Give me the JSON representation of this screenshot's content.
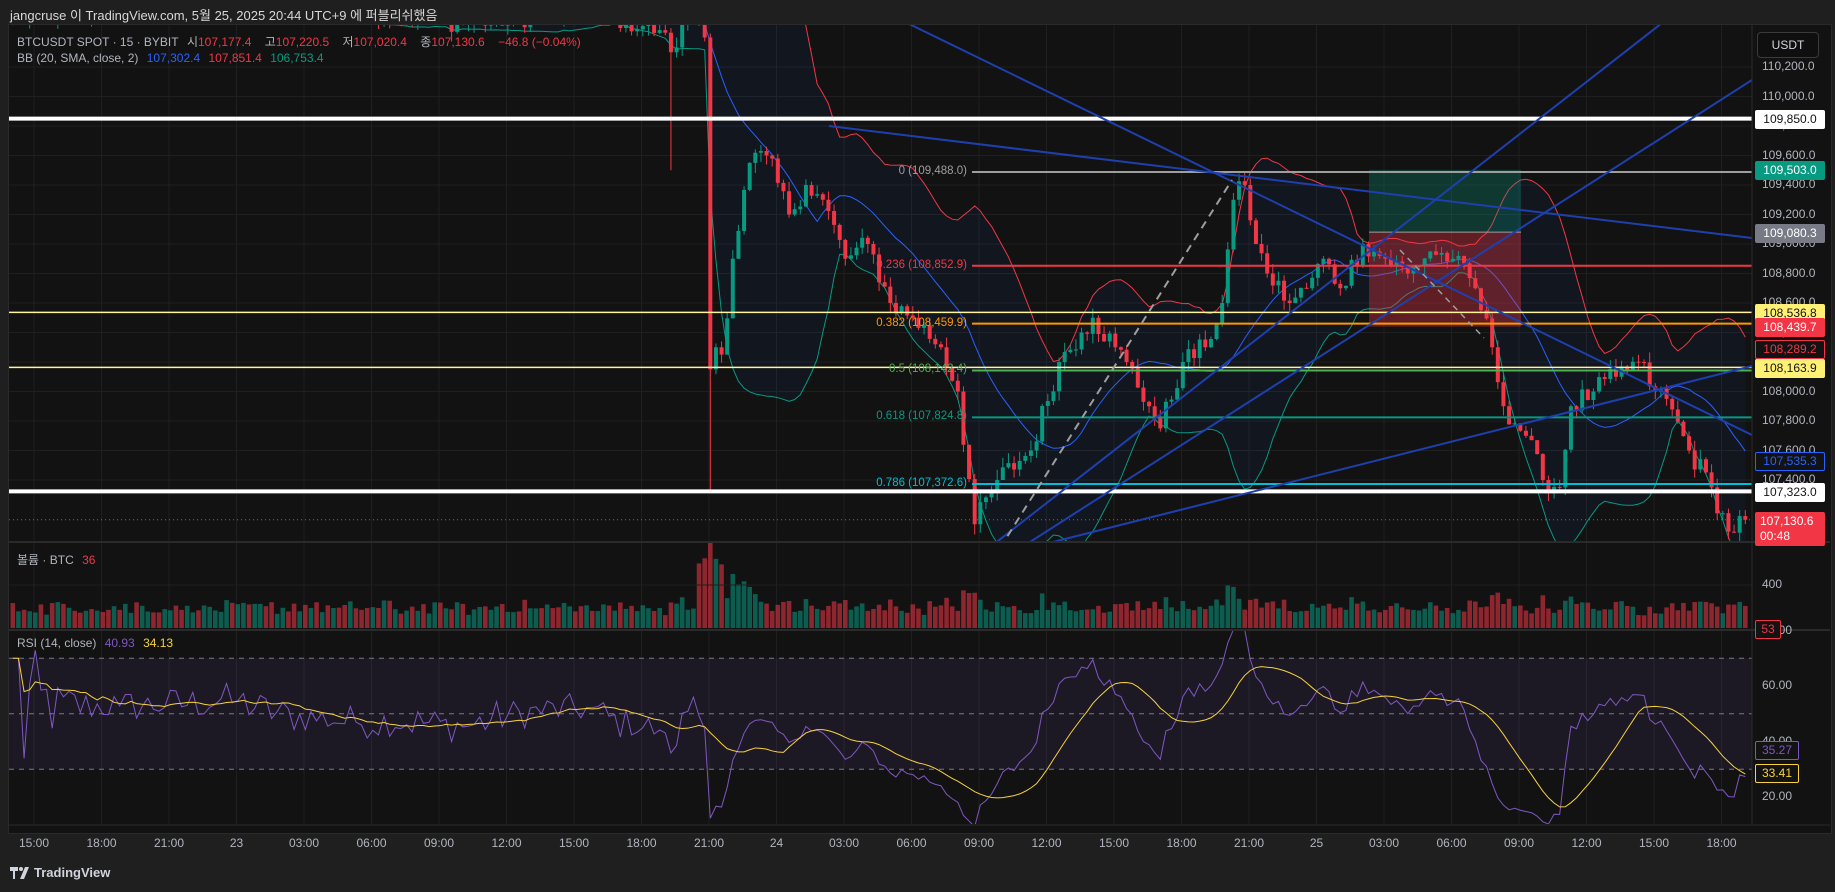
{
  "header": {
    "published": "jangcruse 이 TradingView.com, 5월 25, 2025 20:44 UTC+9 에 퍼블리쉬했음"
  },
  "legend": {
    "symbol": "BTCUSDT SPOT · 15 · BYBIT",
    "open_label": "시",
    "open": "107,177.4",
    "high_label": "고",
    "high": "107,220.5",
    "low_label": "저",
    "low": "107,020.4",
    "close_label": "종",
    "close": "107,130.6",
    "change": "−46.8 (−0.04%)",
    "bb_label": "BB (20, SMA, close, 2)",
    "bb_basis": "107,302.4",
    "bb_upper": "107,851.4",
    "bb_lower": "106,753.4",
    "volume_label": "볼륨 · BTC",
    "volume_value": "36",
    "rsi_label": "RSI (14, close)",
    "rsi_value": "40.93",
    "rsi_ma_value": "34.13"
  },
  "currency_button": "USDT",
  "footer": {
    "brand": "TradingView"
  },
  "colors": {
    "up": "#089981",
    "down": "#f23645",
    "bb_basis": "#2962ff",
    "bb_upper": "#f23645",
    "bb_lower": "#089981",
    "rsi": "#7e57c2",
    "rsi_ma": "#f7d23b",
    "trendline": "#1e40af"
  },
  "chart_data": {
    "type": "candlestick",
    "symbol": "BTCUSDT",
    "interval": "15",
    "price_axis": {
      "ticks": [
        "110,200.0",
        "110,000.0",
        "109,800.0",
        "109,600.0",
        "109,400.0",
        "109,200.0",
        "109,000.0",
        "108,800.0",
        "108,600.0",
        "108,400.0",
        "108,200.0",
        "108,000.0",
        "107,800.0",
        "107,600.0",
        "107,400.0"
      ],
      "tick_values": [
        110200,
        110000,
        109800,
        109600,
        109400,
        109200,
        109000,
        108800,
        108600,
        108400,
        108200,
        108000,
        107800,
        107600,
        107400
      ]
    },
    "time_axis": [
      "15:00",
      "18:00",
      "21:00",
      "23",
      "03:00",
      "06:00",
      "09:00",
      "12:00",
      "15:00",
      "18:00",
      "21:00",
      "24",
      "03:00",
      "06:00",
      "09:00",
      "12:00",
      "15:00",
      "18:00",
      "21:00",
      "25",
      "03:00",
      "06:00",
      "09:00",
      "12:00",
      "15:00",
      "18:00"
    ],
    "candle_count": 309,
    "close_keypoints": [
      [
        0,
        110550
      ],
      [
        19,
        110600
      ],
      [
        40,
        110700
      ],
      [
        61,
        110600
      ],
      [
        81,
        110500
      ],
      [
        102,
        110600
      ],
      [
        115,
        110450
      ],
      [
        117,
        110300
      ],
      [
        121,
        110600
      ],
      [
        123,
        110400
      ],
      [
        124,
        108150
      ],
      [
        125,
        108300
      ],
      [
        126,
        108250
      ],
      [
        128,
        108900
      ],
      [
        131,
        109550
      ],
      [
        134,
        109600
      ],
      [
        138,
        109200
      ],
      [
        141,
        109400
      ],
      [
        144,
        109300
      ],
      [
        148,
        108900
      ],
      [
        152,
        109000
      ],
      [
        156,
        108600
      ],
      [
        160,
        108500
      ],
      [
        165,
        108300
      ],
      [
        168,
        108000
      ],
      [
        171,
        107100
      ],
      [
        175,
        107400
      ],
      [
        181,
        107600
      ],
      [
        186,
        108200
      ],
      [
        190,
        108400
      ],
      [
        192,
        108500
      ],
      [
        196,
        108300
      ],
      [
        198,
        108200
      ],
      [
        202,
        107900
      ],
      [
        204,
        107750
      ],
      [
        208,
        108200
      ],
      [
        212,
        108300
      ],
      [
        215,
        108600
      ],
      [
        217,
        109300
      ],
      [
        219,
        109400
      ],
      [
        221,
        109000
      ],
      [
        223,
        108800
      ],
      [
        227,
        108600
      ],
      [
        230,
        108700
      ],
      [
        233,
        108900
      ],
      [
        236,
        108700
      ],
      [
        240,
        109000
      ],
      [
        244,
        108900
      ],
      [
        248,
        108800
      ],
      [
        252,
        108950
      ],
      [
        256,
        108900
      ],
      [
        260,
        108700
      ],
      [
        263,
        108300
      ],
      [
        265,
        107900
      ],
      [
        269,
        107700
      ],
      [
        272,
        107400
      ],
      [
        275,
        107350
      ],
      [
        277,
        107900
      ],
      [
        281,
        108000
      ],
      [
        285,
        108100
      ],
      [
        289,
        108200
      ],
      [
        292,
        108000
      ],
      [
        294,
        107950
      ],
      [
        298,
        107600
      ],
      [
        302,
        107350
      ],
      [
        305,
        107050
      ],
      [
        308,
        107130.6
      ]
    ],
    "wick_lows": [
      [
        124,
        107330
      ],
      [
        117,
        109500
      ]
    ],
    "horizontal_levels": [
      {
        "price": 109850.0,
        "color": "#ffffff",
        "label": "109,850.0"
      },
      {
        "price": 108536.8,
        "color": "#fff59d",
        "label": "108,536.8"
      },
      {
        "price": 108163.9,
        "color": "#fff59d",
        "label": "108,163.9"
      },
      {
        "price": 107323.0,
        "color": "#ffffff",
        "label": "107,323.0"
      }
    ],
    "fibonacci": [
      {
        "level": "0",
        "price": 109488.0,
        "text": "0 (109,488.0)",
        "color": "#9e9e9e"
      },
      {
        "level": "0.236",
        "price": 108852.9,
        "text": "0.236 (108,852.9)",
        "color": "#f23645"
      },
      {
        "level": "0.382",
        "price": 108459.9,
        "text": "0.382 (108,459.9)",
        "color": "#ff9800"
      },
      {
        "level": "0.5",
        "price": 108142.4,
        "text": "0.5 (108,142.4)",
        "color": "#4caf50"
      },
      {
        "level": "0.618",
        "price": 107824.8,
        "text": "0.618 (107,824.8)",
        "color": "#089981"
      },
      {
        "level": "0.786",
        "price": 107372.6,
        "text": "0.786 (107,372.6)",
        "color": "#00bcd4"
      }
    ],
    "position": {
      "target": 109503.0,
      "entry": 109080.3,
      "stop": 108439.7
    },
    "price_tags": [
      {
        "text": "109,850.0",
        "price": 109850.0,
        "bg": "#ffffff",
        "fg": "#131313",
        "border": "#ffffff"
      },
      {
        "text": "109,503.0",
        "price": 109503.0,
        "bg": "#089981",
        "fg": "#ffffff",
        "border": "#089981"
      },
      {
        "text": "109,080.3",
        "price": 109080.3,
        "bg": "#787b86",
        "fg": "#ffffff",
        "border": "#787b86"
      },
      {
        "text": "108,536.8",
        "price": 108536.8,
        "bg": "#fff176",
        "fg": "#131313",
        "border": "#fff176"
      },
      {
        "text": "108,439.7",
        "price": 108439.7,
        "bg": "#f23645",
        "fg": "#ffffff",
        "border": "#f23645"
      },
      {
        "text": "108,289.2",
        "price": 108289.2,
        "bg": "#131313",
        "fg": "#f23645",
        "border": "#f23645"
      },
      {
        "text": "108,163.9",
        "price": 108163.9,
        "bg": "#fff176",
        "fg": "#131313",
        "border": "#fff176"
      },
      {
        "text": "107,535.3",
        "price": 107535.3,
        "bg": "#131313",
        "fg": "#2962ff",
        "border": "#2962ff"
      },
      {
        "text": "107,323.0",
        "price": 107323.0,
        "bg": "#ffffff",
        "fg": "#131313",
        "border": "#ffffff"
      }
    ],
    "last_price": {
      "text": "107,130.6",
      "countdown": "00:48",
      "price": 107130.6,
      "bg": "#f23645"
    },
    "volume_axis": {
      "ticks": [
        "400"
      ],
      "tick_values": [
        400
      ],
      "last_tag": "53"
    },
    "rsi_axis": {
      "ticks": [
        "80.00",
        "60.00",
        "40.00",
        "20.00"
      ],
      "tick_values": [
        80,
        60,
        40,
        20
      ],
      "bands": [
        70,
        50,
        30
      ],
      "rsi_tag": "35.27",
      "rsi_ma_tag": "33.41"
    }
  }
}
